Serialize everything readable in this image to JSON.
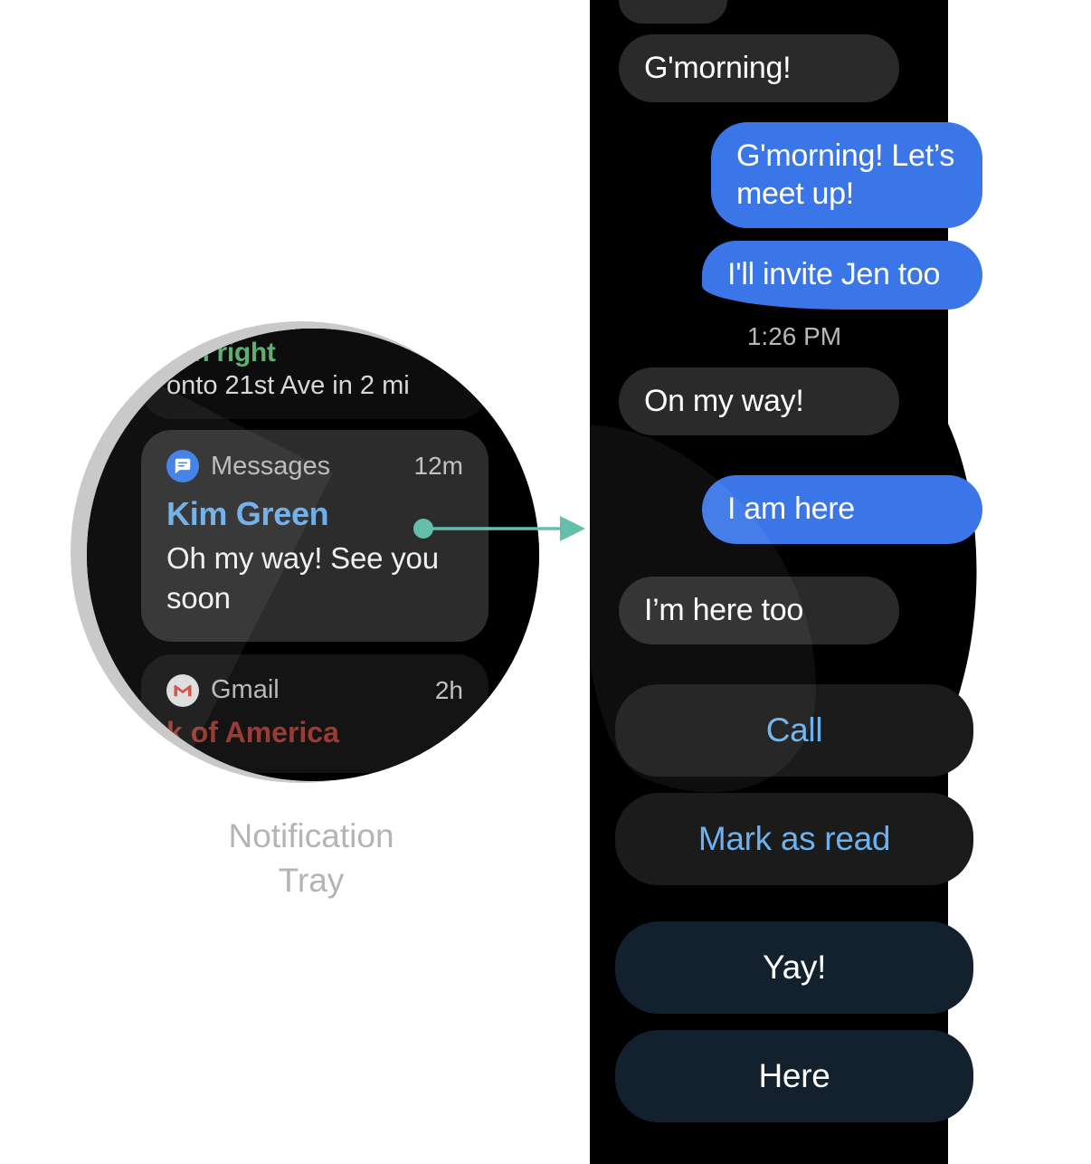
{
  "caption": {
    "line1": "Notification",
    "line2": "Tray"
  },
  "accent_colors": {
    "teal_connector": "#63bfac",
    "bubble_blue": "#3b76e8",
    "bubble_gray": "#2a2a2a",
    "action_neutral_bg": "#1b1b1b",
    "action_neutral_text": "#6cb2f0",
    "action_reply_bg": "#13202e",
    "sender_blue": "#6cadeb",
    "nav_green": "#5fae73",
    "gmail_red": "#9a3b34",
    "bezel_silver": "#c9c9c9",
    "caption_gray": "#b4b4b4"
  },
  "watch_tray": {
    "nav_notification": {
      "line1": "urn right",
      "line2": "onto 21st Ave in 2 mi"
    },
    "messages_notification": {
      "app_icon": "messages-icon",
      "app_name": "Messages",
      "time": "12m",
      "sender": "Kim Green",
      "body": "Oh my way! See you soon"
    },
    "gmail_notification": {
      "app_icon": "gmail-icon",
      "app_name": "Gmail",
      "time": "2h",
      "subject": "k of America"
    }
  },
  "conversation": {
    "time_separator": "1:26 PM",
    "messages": [
      {
        "text": "G'morning!",
        "side": "them"
      },
      {
        "text": "G'morning! Let’s meet up!",
        "side": "me"
      },
      {
        "text": "I'll invite Jen too",
        "side": "me"
      },
      {
        "text": "On my way!",
        "side": "them"
      },
      {
        "text": "I am here",
        "side": "me"
      },
      {
        "text": "I’m here too",
        "side": "them"
      }
    ]
  },
  "actions": [
    {
      "label": "Call",
      "style": "neutral"
    },
    {
      "label": "Mark as read",
      "style": "neutral"
    }
  ],
  "quick_replies": [
    {
      "label": "Yay!",
      "style": "reply"
    },
    {
      "label": "Here",
      "style": "reply"
    }
  ]
}
